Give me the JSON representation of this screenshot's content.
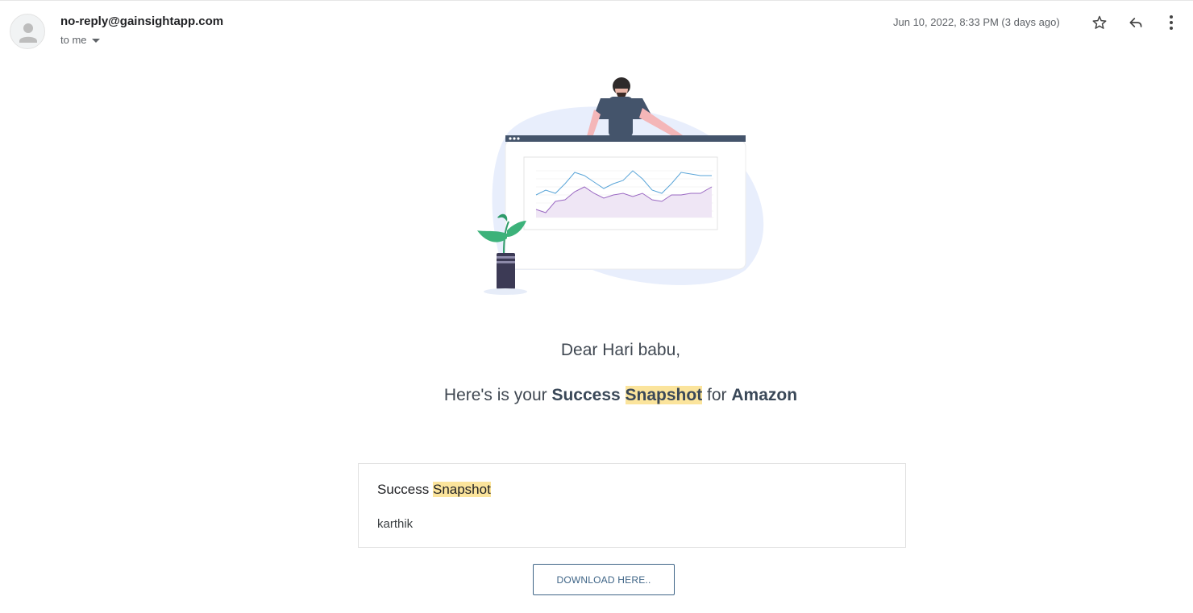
{
  "header": {
    "sender": "no-reply@gainsightapp.com",
    "recipient": "to me",
    "timestamp": "Jun 10, 2022, 8:33 PM (3 days ago)",
    "icons": [
      "avatar-icon",
      "star-icon",
      "reply-icon",
      "more-vert-icon",
      "chevron-down-icon"
    ]
  },
  "body": {
    "greeting": "Dear Hari babu,",
    "intro": {
      "prefix": "Here's is your ",
      "word1": "Success",
      "word2": "Snapshot",
      "middle": " for ",
      "company": "Amazon"
    },
    "card": {
      "title_word1": "Success",
      "title_word2": "Snapshot",
      "user": "karthik"
    },
    "button_label": "DOWNLOAD HERE.."
  },
  "colors": {
    "highlight": "#fbe49c",
    "accent": "#3f6587",
    "text": "#404852"
  }
}
